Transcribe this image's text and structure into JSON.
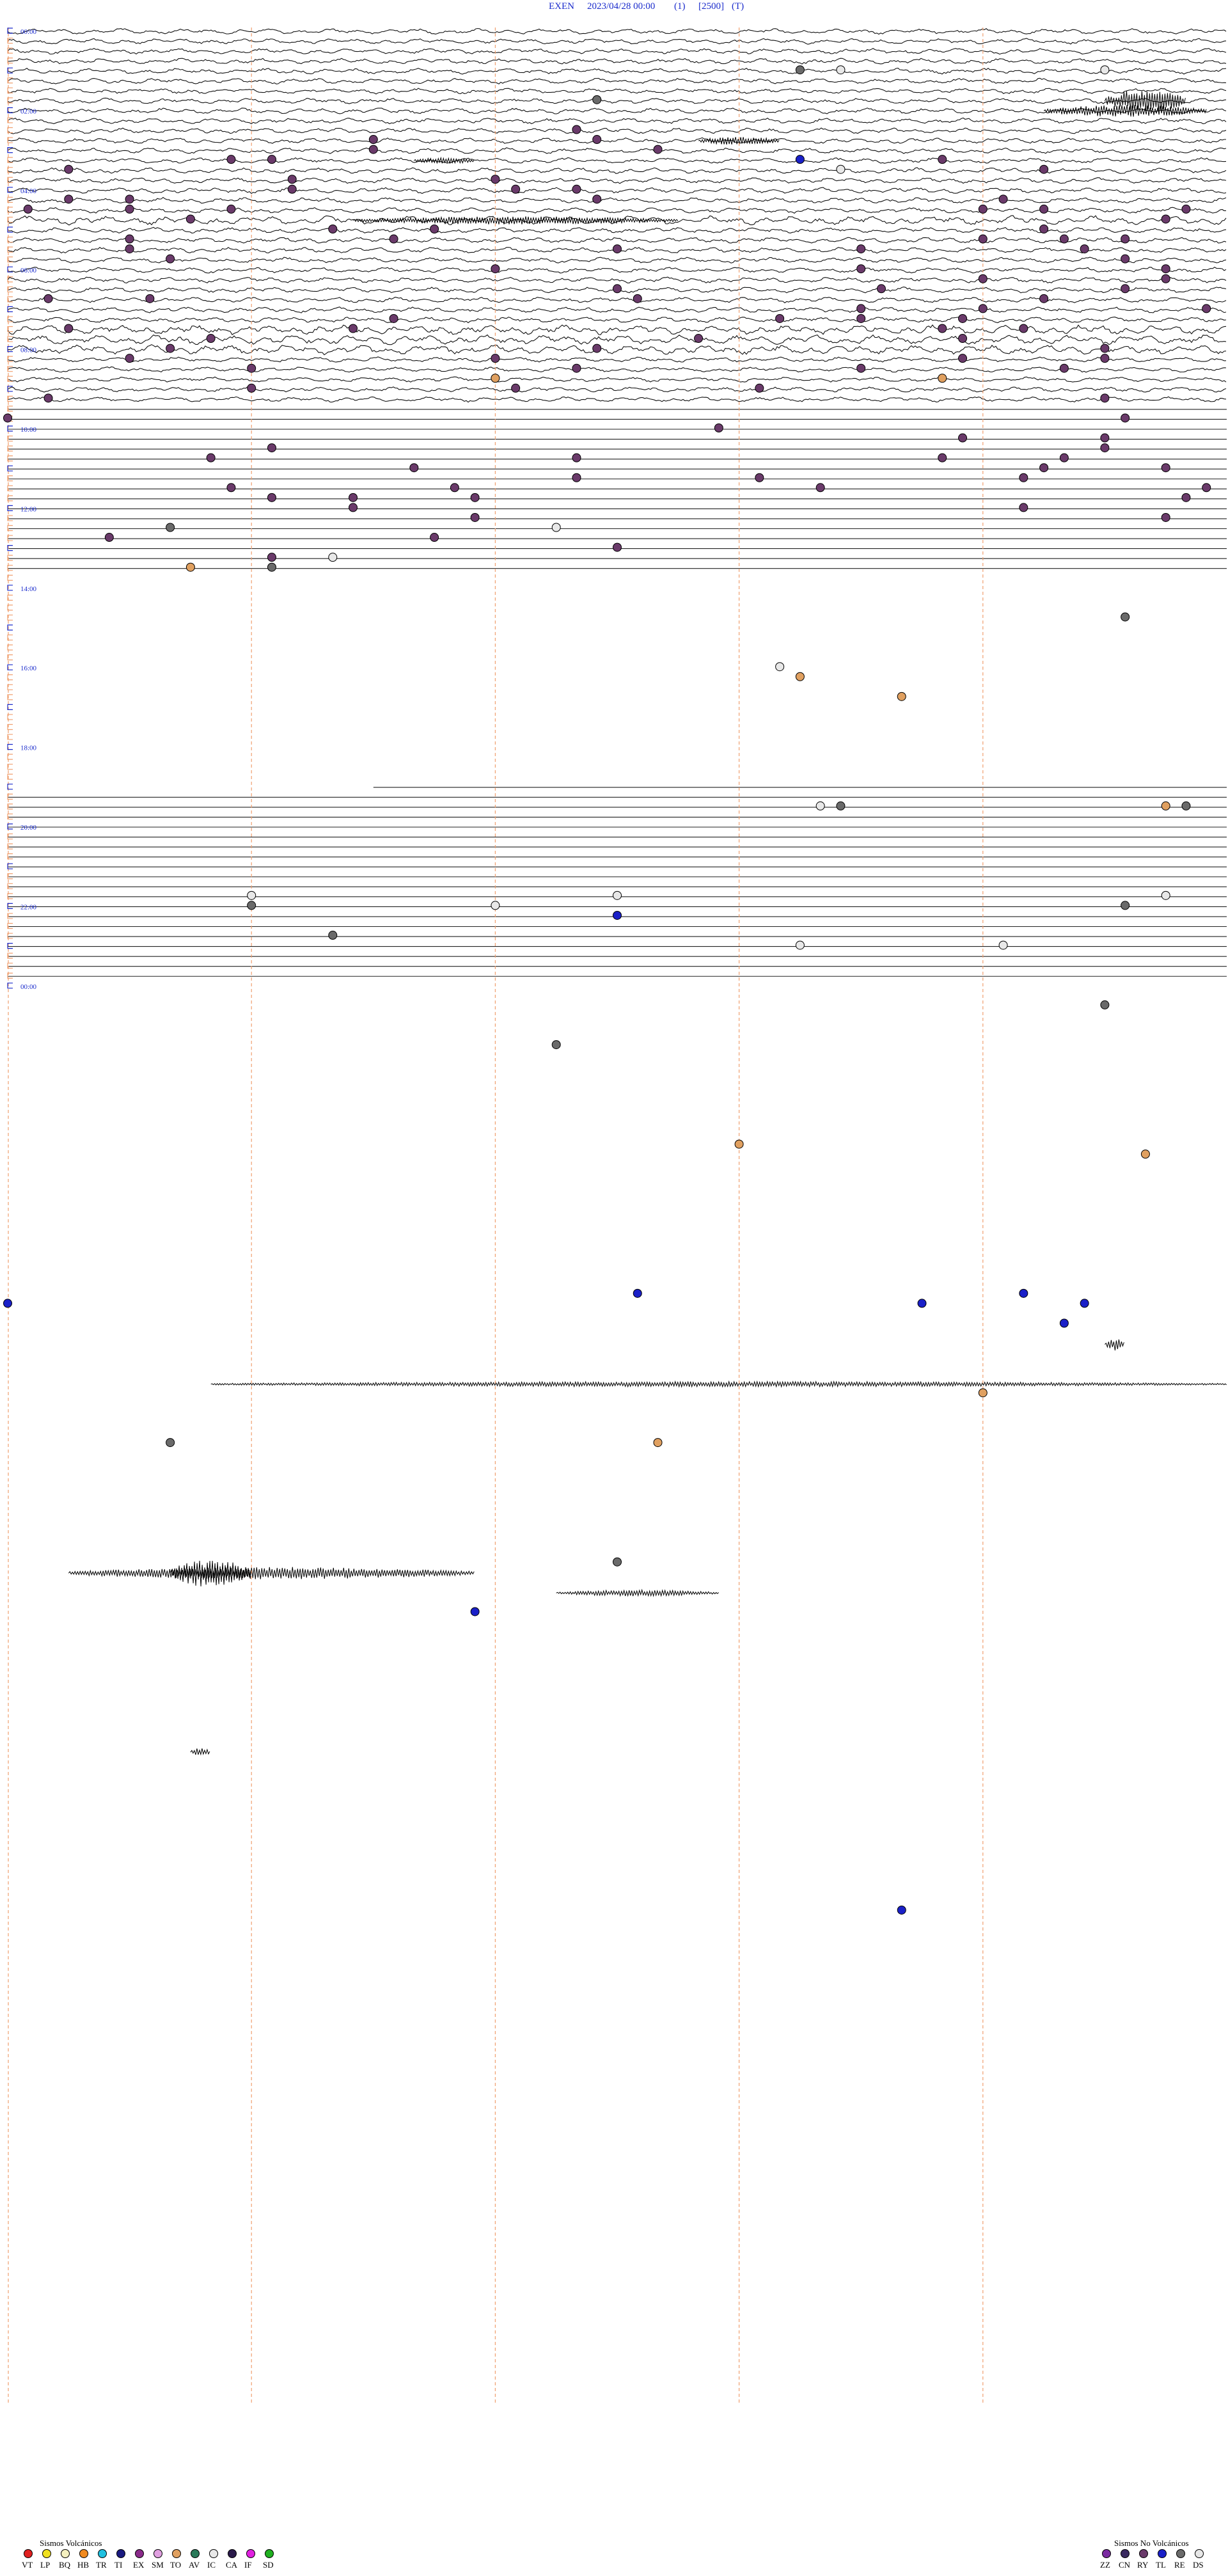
{
  "header": {
    "station": "EXEN",
    "datetime": "2023/04/28 00:00",
    "channel": "(1)",
    "scale": "[2500]",
    "mode": "(T)"
  },
  "chart_data": {
    "type": "helicorder",
    "rows_per_hour": 4,
    "hours": 24,
    "time_labels": [
      {
        "hour": 0,
        "text": "00:00"
      },
      {
        "hour": 2,
        "text": "02:00"
      },
      {
        "hour": 4,
        "text": "04:00"
      },
      {
        "hour": 6,
        "text": "06:00"
      },
      {
        "hour": 8,
        "text": "08:00"
      },
      {
        "hour": 10,
        "text": "10:00"
      },
      {
        "hour": 12,
        "text": "12:00"
      },
      {
        "hour": 14,
        "text": "14:00"
      },
      {
        "hour": 16,
        "text": "16:00"
      },
      {
        "hour": 18,
        "text": "18:00"
      },
      {
        "hour": 20,
        "text": "20:00"
      },
      {
        "hour": 22,
        "text": "22:00"
      },
      {
        "hour": 24,
        "text": "00:00"
      }
    ],
    "minute_markers": [
      0,
      12,
      24,
      36,
      48
    ],
    "segments": [
      {
        "from_row": 0,
        "to_row": 19,
        "state": "noisy",
        "amplitude": 1.0
      },
      {
        "from_row": 19,
        "to_row": 20,
        "state": "noisy",
        "amplitude": 1.6
      },
      {
        "from_row": 20,
        "to_row": 30,
        "state": "noisy",
        "amplitude": 1.0
      },
      {
        "from_row": 30,
        "to_row": 33,
        "state": "noisy",
        "amplitude": 1.7
      },
      {
        "from_row": 33,
        "to_row": 38,
        "state": "noisy",
        "amplitude": 0.9
      },
      {
        "from_row": 38,
        "to_row": 55,
        "state": "flat"
      },
      {
        "from_row": 55,
        "to_row": 76,
        "state": "blank"
      },
      {
        "from_row": 76,
        "to_row": 77,
        "state": "flat",
        "starts_at_minute": 18
      },
      {
        "from_row": 77,
        "to_row": 126,
        "state": "flat"
      },
      {
        "from_row": 126,
        "to_row": 128,
        "state": "noisy",
        "amplitude": 0.8
      },
      {
        "from_row": 128,
        "to_row": 148,
        "state": "noisy",
        "amplitude": 1.0
      },
      {
        "from_row": 148,
        "to_row": 158,
        "state": "noisy",
        "amplitude": 1.3
      },
      {
        "from_row": 158,
        "to_row": 173,
        "state": "noisy",
        "amplitude": 1.5
      },
      {
        "from_row": 173,
        "to_row": 192,
        "state": "noisy",
        "amplitude": 1.4
      }
    ],
    "bursts": [
      {
        "row": 7,
        "minute": 54,
        "minutes": 4,
        "amplitude": 6
      },
      {
        "row": 8,
        "minute": 51,
        "minutes": 8,
        "amplitude": 3
      },
      {
        "row": 11,
        "minute": 34,
        "minutes": 4,
        "amplitude": 2
      },
      {
        "row": 13,
        "minute": 20,
        "minutes": 3,
        "amplitude": 1.5
      },
      {
        "row": 19,
        "minute": 17,
        "minutes": 16,
        "amplitude": 2
      },
      {
        "row": 132,
        "minute": 54,
        "minutes": 1,
        "amplitude": 3
      },
      {
        "row": 136,
        "minute": 10,
        "minutes": 50,
        "amplitude": 1.3
      },
      {
        "row": 155,
        "minute": 3,
        "minutes": 20,
        "amplitude": 3
      },
      {
        "row": 155,
        "minute": 8,
        "minutes": 4,
        "amplitude": 7
      },
      {
        "row": 157,
        "minute": 27,
        "minutes": 8,
        "amplitude": 1.5
      },
      {
        "row": 173,
        "minute": 9,
        "minutes": 1,
        "amplitude": 2
      }
    ],
    "event_types": {
      "volcanic": [
        {
          "code": "VT",
          "color": "#e02020"
        },
        {
          "code": "LP",
          "color": "#f0e020"
        },
        {
          "code": "BQ",
          "color": "#f4f0c0"
        },
        {
          "code": "HB",
          "color": "#f08a20"
        },
        {
          "code": "TR",
          "color": "#20c0e0"
        },
        {
          "code": "TI",
          "color": "#1a1a80"
        },
        {
          "code": "EX",
          "color": "#8a2a8a"
        },
        {
          "code": "SM",
          "color": "#e0a0e0"
        },
        {
          "code": "TO",
          "color": "#e0a060"
        },
        {
          "code": "AV",
          "color": "#2a7a5a"
        },
        {
          "code": "IC",
          "color": "#e8e8e8"
        },
        {
          "code": "CA",
          "color": "#2a1a4a"
        },
        {
          "code": "IF",
          "color": "#e020e0"
        },
        {
          "code": "SD",
          "color": "#20b020"
        }
      ],
      "non_volcanic": [
        {
          "code": "ZZ",
          "color": "#7a2aa0"
        },
        {
          "code": "CN",
          "color": "#3a2a60"
        },
        {
          "code": "RY",
          "color": "#6a3a6a"
        },
        {
          "code": "TL",
          "color": "#1a20c8"
        },
        {
          "code": "RE",
          "color": "#6a6a6a"
        },
        {
          "code": "DS",
          "color": "#e8e8e8"
        }
      ]
    },
    "events": [
      {
        "row": 4,
        "minute": 39,
        "type": "RE"
      },
      {
        "row": 4,
        "minute": 41,
        "type": "DS"
      },
      {
        "row": 4,
        "minute": 54,
        "type": "IC"
      },
      {
        "row": 7,
        "minute": 29,
        "type": "RE"
      },
      {
        "row": 10,
        "minute": 28,
        "type": "RY"
      },
      {
        "row": 11,
        "minute": 29,
        "type": "RY"
      },
      {
        "row": 11,
        "minute": 18,
        "type": "RY"
      },
      {
        "row": 12,
        "minute": 18,
        "type": "RY"
      },
      {
        "row": 12,
        "minute": 32,
        "type": "RY"
      },
      {
        "row": 13,
        "minute": 39,
        "type": "TL"
      },
      {
        "row": 13,
        "minute": 46,
        "type": "RY"
      },
      {
        "row": 13,
        "minute": 11,
        "type": "RY"
      },
      {
        "row": 13,
        "minute": 13,
        "type": "RY"
      },
      {
        "row": 14,
        "minute": 3,
        "type": "RY"
      },
      {
        "row": 14,
        "minute": 41,
        "type": "IC"
      },
      {
        "row": 14,
        "minute": 51,
        "type": "RY"
      },
      {
        "row": 15,
        "minute": 14,
        "type": "RY"
      },
      {
        "row": 15,
        "minute": 24,
        "type": "RY"
      },
      {
        "row": 16,
        "minute": 14,
        "type": "RY"
      },
      {
        "row": 16,
        "minute": 25,
        "type": "RY"
      },
      {
        "row": 16,
        "minute": 28,
        "type": "RY"
      },
      {
        "row": 17,
        "minute": 3,
        "type": "RY"
      },
      {
        "row": 17,
        "minute": 6,
        "type": "RY"
      },
      {
        "row": 17,
        "minute": 29,
        "type": "RY"
      },
      {
        "row": 17,
        "minute": 49,
        "type": "RY"
      },
      {
        "row": 18,
        "minute": 1,
        "type": "RY"
      },
      {
        "row": 18,
        "minute": 6,
        "type": "RY"
      },
      {
        "row": 18,
        "minute": 11,
        "type": "RY"
      },
      {
        "row": 18,
        "minute": 48,
        "type": "RY"
      },
      {
        "row": 18,
        "minute": 51,
        "type": "RY"
      },
      {
        "row": 18,
        "minute": 58,
        "type": "RY"
      },
      {
        "row": 19,
        "minute": 9,
        "type": "RY"
      },
      {
        "row": 19,
        "minute": 57,
        "type": "RY"
      },
      {
        "row": 20,
        "minute": 16,
        "type": "RY"
      },
      {
        "row": 20,
        "minute": 21,
        "type": "RY"
      },
      {
        "row": 20,
        "minute": 51,
        "type": "RY"
      },
      {
        "row": 21,
        "minute": 6,
        "type": "RY"
      },
      {
        "row": 21,
        "minute": 19,
        "type": "RY"
      },
      {
        "row": 21,
        "minute": 48,
        "type": "RY"
      },
      {
        "row": 21,
        "minute": 52,
        "type": "RY"
      },
      {
        "row": 21,
        "minute": 55,
        "type": "RY"
      },
      {
        "row": 22,
        "minute": 6,
        "type": "RY"
      },
      {
        "row": 22,
        "minute": 30,
        "type": "RY"
      },
      {
        "row": 22,
        "minute": 42,
        "type": "RY"
      },
      {
        "row": 22,
        "minute": 53,
        "type": "RY"
      },
      {
        "row": 23,
        "minute": 8,
        "type": "RY"
      },
      {
        "row": 23,
        "minute": 55,
        "type": "RY"
      },
      {
        "row": 24,
        "minute": 24,
        "type": "RY"
      },
      {
        "row": 24,
        "minute": 42,
        "type": "RY"
      },
      {
        "row": 24,
        "minute": 57,
        "type": "RY"
      },
      {
        "row": 25,
        "minute": 48,
        "type": "RY"
      },
      {
        "row": 25,
        "minute": 57,
        "type": "RY"
      },
      {
        "row": 26,
        "minute": 30,
        "type": "RY"
      },
      {
        "row": 26,
        "minute": 43,
        "type": "RY"
      },
      {
        "row": 26,
        "minute": 55,
        "type": "RY"
      },
      {
        "row": 27,
        "minute": 2,
        "type": "RY"
      },
      {
        "row": 27,
        "minute": 7,
        "type": "RY"
      },
      {
        "row": 27,
        "minute": 31,
        "type": "RY"
      },
      {
        "row": 27,
        "minute": 51,
        "type": "RY"
      },
      {
        "row": 28,
        "minute": 42,
        "type": "RY"
      },
      {
        "row": 28,
        "minute": 48,
        "type": "RY"
      },
      {
        "row": 28,
        "minute": 59,
        "type": "RY"
      },
      {
        "row": 29,
        "minute": 19,
        "type": "RY"
      },
      {
        "row": 29,
        "minute": 38,
        "type": "RY"
      },
      {
        "row": 29,
        "minute": 42,
        "type": "RY"
      },
      {
        "row": 29,
        "minute": 47,
        "type": "RY"
      },
      {
        "row": 30,
        "minute": 3,
        "type": "RY"
      },
      {
        "row": 30,
        "minute": 17,
        "type": "RY"
      },
      {
        "row": 30,
        "minute": 46,
        "type": "RY"
      },
      {
        "row": 30,
        "minute": 50,
        "type": "RY"
      },
      {
        "row": 31,
        "minute": 10,
        "type": "RY"
      },
      {
        "row": 31,
        "minute": 34,
        "type": "RY"
      },
      {
        "row": 31,
        "minute": 47,
        "type": "RY"
      },
      {
        "row": 32,
        "minute": 8,
        "type": "RY"
      },
      {
        "row": 32,
        "minute": 29,
        "type": "RY"
      },
      {
        "row": 32,
        "minute": 54,
        "type": "RY"
      },
      {
        "row": 33,
        "minute": 6,
        "type": "RY"
      },
      {
        "row": 33,
        "minute": 24,
        "type": "RY"
      },
      {
        "row": 33,
        "minute": 47,
        "type": "RY"
      },
      {
        "row": 33,
        "minute": 54,
        "type": "RY"
      },
      {
        "row": 34,
        "minute": 12,
        "type": "RY"
      },
      {
        "row": 34,
        "minute": 28,
        "type": "RY"
      },
      {
        "row": 34,
        "minute": 42,
        "type": "RY"
      },
      {
        "row": 34,
        "minute": 52,
        "type": "RY"
      },
      {
        "row": 35,
        "minute": 24,
        "type": "TO"
      },
      {
        "row": 35,
        "minute": 46,
        "type": "TO"
      },
      {
        "row": 36,
        "minute": 12,
        "type": "RY"
      },
      {
        "row": 36,
        "minute": 25,
        "type": "RY"
      },
      {
        "row": 36,
        "minute": 37,
        "type": "RY"
      },
      {
        "row": 37,
        "minute": 2,
        "type": "RY"
      },
      {
        "row": 37,
        "minute": 54,
        "type": "RY"
      },
      {
        "row": 39,
        "minute": 0,
        "type": "RY"
      },
      {
        "row": 39,
        "minute": 55,
        "type": "RY"
      },
      {
        "row": 40,
        "minute": 35,
        "type": "RY"
      },
      {
        "row": 41,
        "minute": 54,
        "type": "RY"
      },
      {
        "row": 41,
        "minute": 47,
        "type": "RY"
      },
      {
        "row": 42,
        "minute": 13,
        "type": "RY"
      },
      {
        "row": 42,
        "minute": 54,
        "type": "RY"
      },
      {
        "row": 43,
        "minute": 10,
        "type": "RY"
      },
      {
        "row": 43,
        "minute": 28,
        "type": "RY"
      },
      {
        "row": 43,
        "minute": 46,
        "type": "RY"
      },
      {
        "row": 43,
        "minute": 52,
        "type": "RY"
      },
      {
        "row": 44,
        "minute": 20,
        "type": "RY"
      },
      {
        "row": 44,
        "minute": 51,
        "type": "RY"
      },
      {
        "row": 44,
        "minute": 57,
        "type": "RY"
      },
      {
        "row": 45,
        "minute": 28,
        "type": "RY"
      },
      {
        "row": 45,
        "minute": 37,
        "type": "RY"
      },
      {
        "row": 45,
        "minute": 50,
        "type": "RY"
      },
      {
        "row": 46,
        "minute": 11,
        "type": "RY"
      },
      {
        "row": 46,
        "minute": 22,
        "type": "RY"
      },
      {
        "row": 46,
        "minute": 40,
        "type": "RY"
      },
      {
        "row": 46,
        "minute": 59,
        "type": "RY"
      },
      {
        "row": 47,
        "minute": 13,
        "type": "RY"
      },
      {
        "row": 47,
        "minute": 17,
        "type": "RY"
      },
      {
        "row": 47,
        "minute": 23,
        "type": "RY"
      },
      {
        "row": 47,
        "minute": 58,
        "type": "RY"
      },
      {
        "row": 48,
        "minute": 17,
        "type": "RY"
      },
      {
        "row": 48,
        "minute": 50,
        "type": "RY"
      },
      {
        "row": 49,
        "minute": 23,
        "type": "RY"
      },
      {
        "row": 49,
        "minute": 57,
        "type": "RY"
      },
      {
        "row": 50,
        "minute": 8,
        "type": "RE"
      },
      {
        "row": 50,
        "minute": 27,
        "type": "IC"
      },
      {
        "row": 51,
        "minute": 5,
        "type": "RY"
      },
      {
        "row": 51,
        "minute": 21,
        "type": "RY"
      },
      {
        "row": 52,
        "minute": 30,
        "type": "RY"
      },
      {
        "row": 53,
        "minute": 13,
        "type": "RY"
      },
      {
        "row": 53,
        "minute": 16,
        "type": "IC"
      },
      {
        "row": 54,
        "minute": 9,
        "type": "TO"
      },
      {
        "row": 54,
        "minute": 13,
        "type": "RE"
      },
      {
        "row": 59,
        "minute": 55,
        "type": "RE"
      },
      {
        "row": 64,
        "minute": 38,
        "type": "IC"
      },
      {
        "row": 65,
        "minute": 39,
        "type": "TO"
      },
      {
        "row": 67,
        "minute": 44,
        "type": "TO"
      },
      {
        "row": 78,
        "minute": 40,
        "type": "IC"
      },
      {
        "row": 78,
        "minute": 41,
        "type": "RE"
      },
      {
        "row": 78,
        "minute": 57,
        "type": "TO"
      },
      {
        "row": 78,
        "minute": 58,
        "type": "RE"
      },
      {
        "row": 87,
        "minute": 12,
        "type": "IC"
      },
      {
        "row": 87,
        "minute": 30,
        "type": "IC"
      },
      {
        "row": 87,
        "minute": 57,
        "type": "IC"
      },
      {
        "row": 88,
        "minute": 12,
        "type": "RE"
      },
      {
        "row": 88,
        "minute": 24,
        "type": "IC"
      },
      {
        "row": 88,
        "minute": 55,
        "type": "RE"
      },
      {
        "row": 89,
        "minute": 30,
        "type": "TL"
      },
      {
        "row": 91,
        "minute": 16,
        "type": "RE"
      },
      {
        "row": 92,
        "minute": 39,
        "type": "IC"
      },
      {
        "row": 92,
        "minute": 49,
        "type": "IC"
      },
      {
        "row": 98,
        "minute": 54,
        "type": "RE"
      },
      {
        "row": 102,
        "minute": 27,
        "type": "RE"
      },
      {
        "row": 112,
        "minute": 36,
        "type": "TO"
      },
      {
        "row": 113,
        "minute": 56,
        "type": "TO"
      },
      {
        "row": 127,
        "minute": 31,
        "type": "TL"
      },
      {
        "row": 127,
        "minute": 50,
        "type": "TL"
      },
      {
        "row": 128,
        "minute": 0,
        "type": "TL"
      },
      {
        "row": 128,
        "minute": 45,
        "type": "TL"
      },
      {
        "row": 128,
        "minute": 53,
        "type": "TL"
      },
      {
        "row": 130,
        "minute": 52,
        "type": "TL"
      },
      {
        "row": 137,
        "minute": 48,
        "type": "TO"
      },
      {
        "row": 142,
        "minute": 8,
        "type": "RE"
      },
      {
        "row": 142,
        "minute": 32,
        "type": "TO"
      },
      {
        "row": 154,
        "minute": 30,
        "type": "RE"
      },
      {
        "row": 159,
        "minute": 23,
        "type": "TL"
      },
      {
        "row": 189,
        "minute": 44,
        "type": "TL"
      }
    ]
  },
  "legend": {
    "volcanic_title": "Sismos Volcánicos",
    "non_volcanic_title": "Sismos No Volcánicos"
  }
}
